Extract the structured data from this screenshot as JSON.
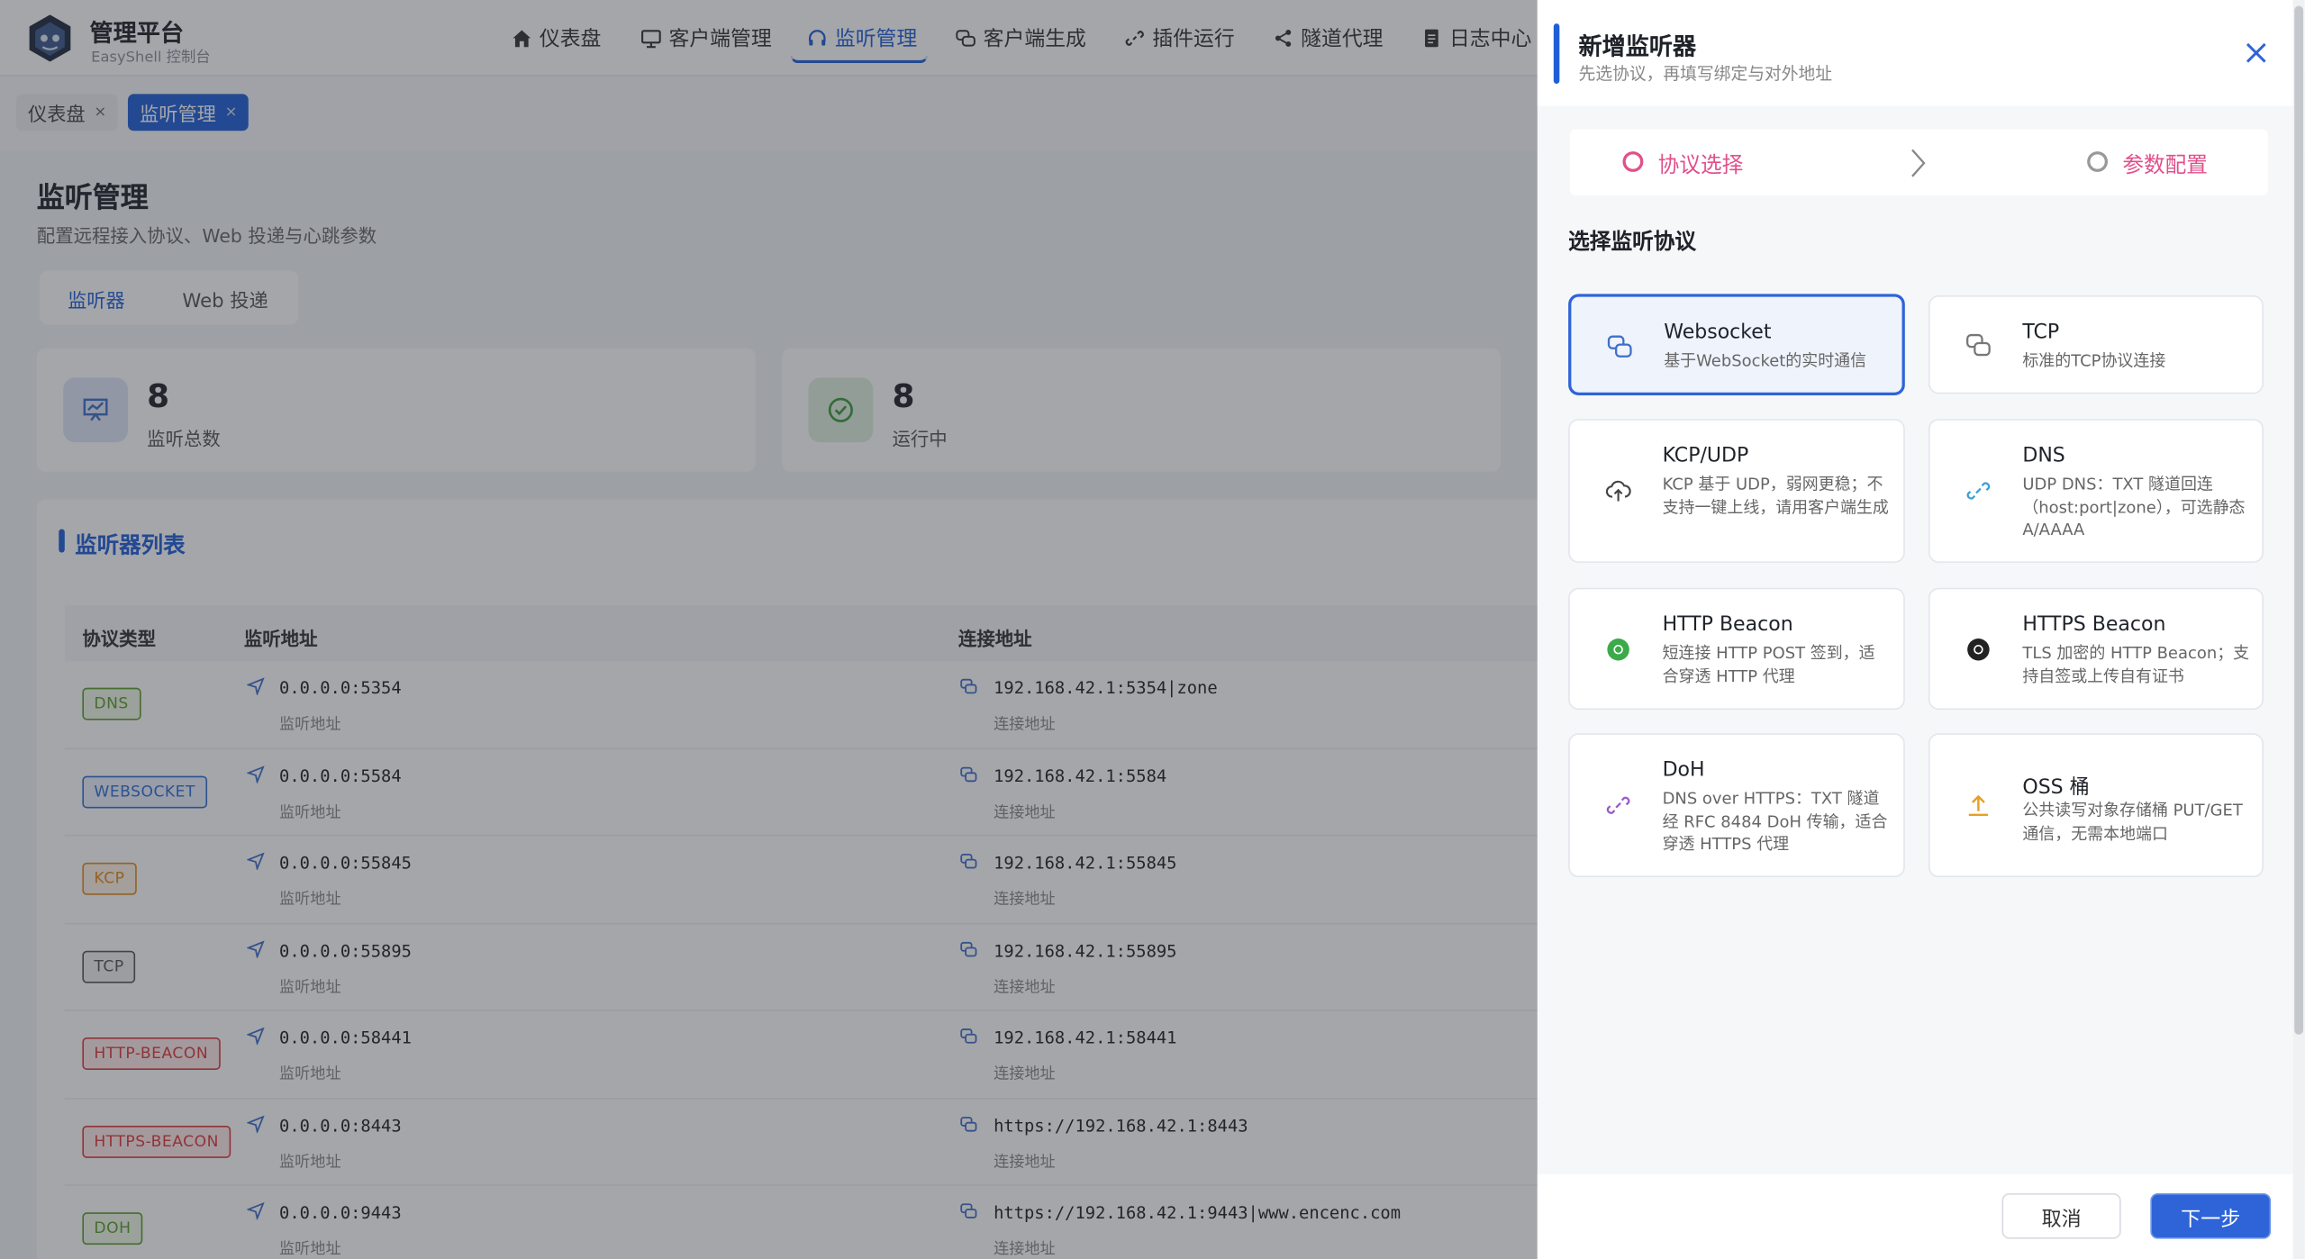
{
  "app": {
    "title": "管理平台",
    "subtitle": "EasyShell 控制台"
  },
  "nav": {
    "items": [
      {
        "label": "仪表盘",
        "icon": "home-icon"
      },
      {
        "label": "客户端管理",
        "icon": "monitor-icon"
      },
      {
        "label": "监听管理",
        "icon": "headset-icon",
        "active": true
      },
      {
        "label": "客户端生成",
        "icon": "chat-icon"
      },
      {
        "label": "插件运行",
        "icon": "link-icon"
      },
      {
        "label": "隧道代理",
        "icon": "share-icon"
      },
      {
        "label": "日志中心",
        "icon": "document-icon"
      }
    ]
  },
  "open_tabs": [
    {
      "label": "仪表盘",
      "close": "×"
    },
    {
      "label": "监听管理",
      "close": "×",
      "active": true
    }
  ],
  "page": {
    "title": "监听管理",
    "description": "配置远程接入协议、Web 投递与心跳参数",
    "subtabs": [
      "监听器",
      "Web 投递"
    ]
  },
  "stats": [
    {
      "value": "8",
      "label": "监听总数"
    },
    {
      "value": "8",
      "label": "运行中"
    }
  ],
  "list": {
    "title": "监听器列表",
    "columns": [
      "协议类型",
      "监听地址",
      "连接地址"
    ],
    "listen_sub": "监听地址",
    "connect_sub": "连接地址",
    "rows": [
      {
        "protocol": "DNS",
        "listen": "0.0.0.0:5354",
        "connect": "192.168.42.1:5354|zone"
      },
      {
        "protocol": "WEBSOCKET",
        "listen": "0.0.0.0:5584",
        "connect": "192.168.42.1:5584"
      },
      {
        "protocol": "KCP",
        "listen": "0.0.0.0:55845",
        "connect": "192.168.42.1:55845"
      },
      {
        "protocol": "TCP",
        "listen": "0.0.0.0:55895",
        "connect": "192.168.42.1:55895"
      },
      {
        "protocol": "HTTP-BEACON",
        "listen": "0.0.0.0:58441",
        "connect": "192.168.42.1:58441"
      },
      {
        "protocol": "HTTPS-BEACON",
        "listen": "0.0.0.0:8443",
        "connect": "https://192.168.42.1:8443"
      },
      {
        "protocol": "DOH",
        "listen": "0.0.0.0:9443",
        "connect": "https://192.168.42.1:9443|www.encenc.com"
      }
    ]
  },
  "drawer": {
    "title": "新增监听器",
    "subtitle": "先选协议，再填写绑定与对外地址",
    "steps": [
      "协议选择",
      "参数配置"
    ],
    "section_title": "选择监听协议",
    "protocols": [
      {
        "name": "Websocket",
        "desc": "基于WebSocket的实时通信",
        "icon": "websocket-icon",
        "selected": true
      },
      {
        "name": "TCP",
        "desc": "标准的TCP协议连接",
        "icon": "tcp-icon"
      },
      {
        "name": "KCP/UDP",
        "desc": "KCP 基于 UDP，弱网更稳；不支持一键上线，请用客户端生成",
        "icon": "cloud-upload-icon"
      },
      {
        "name": "DNS",
        "desc": "UDP DNS：TXT 隧道回连（host:port|zone），可选静态 A/AAAA",
        "icon": "link-icon"
      },
      {
        "name": "HTTP Beacon",
        "desc": "短连接 HTTP POST 签到，适合穿透 HTTP 代理",
        "icon": "chrome-green-icon"
      },
      {
        "name": "HTTPS Beacon",
        "desc": "TLS 加密的 HTTP Beacon；支持自签或上传自有证书",
        "icon": "chrome-dark-icon"
      },
      {
        "name": "DoH",
        "desc": "DNS over HTTPS：TXT 隧道经 RFC 8484 DoH 传输，适合穿透 HTTPS 代理",
        "icon": "link-purple-icon"
      },
      {
        "name": "OSS 桶",
        "desc": "公共读写对象存储桶 PUT/GET 通信，无需本地端口",
        "icon": "upload-icon"
      }
    ],
    "cancel": "取消",
    "next": "下一步"
  },
  "colors": {
    "primary": "#1f5fd6",
    "step_pink": "#e0508a",
    "dns": "#5b9e2c",
    "websocket": "#2f6fd1",
    "kcp": "#e08a1a",
    "tcp": "#555555",
    "beacon": "#d93b3b",
    "doh": "#5b9e2c"
  }
}
